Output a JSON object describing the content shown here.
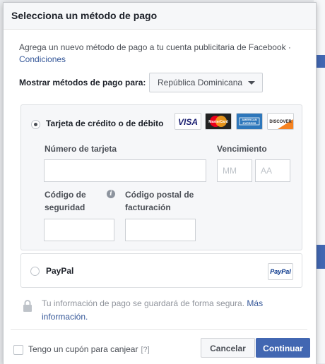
{
  "dialog": {
    "title": "Selecciona un método de pago",
    "description": "Agrega un nuevo método de pago a tu cuenta publicitaria de Facebook ·",
    "conditions_link": "Condiciones"
  },
  "show_methods": {
    "label": "Mostrar métodos de pago para:",
    "country": "República Dominicana"
  },
  "card_option": {
    "label": "Tarjeta de crédito o de débito",
    "selected": true,
    "logos": [
      "VISA",
      "MasterCard",
      "AMERICAN EXPRESS",
      "DISCOVER"
    ],
    "card_number_label": "Número de tarjeta",
    "expiry_label": "Vencimiento",
    "month_placeholder": "MM",
    "year_placeholder": "AA",
    "security_code_label_1": "Código de",
    "security_code_label_2": "seguridad",
    "postal_code_label_1": "Código postal de",
    "postal_code_label_2": "facturación"
  },
  "paypal_option": {
    "label": "PayPal",
    "selected": false,
    "logo_text": "PayPal"
  },
  "secure_note": {
    "text": "Tu información de pago se guardará de forma segura.",
    "link_1": "Más",
    "link_2": "información."
  },
  "footer": {
    "coupon_label": "Tengo un cupón para canjear",
    "coupon_help": "[?]",
    "cancel_label": "Cancelar",
    "continue_label": "Continuar"
  },
  "colors": {
    "primary": "#4267b2",
    "link": "#365899",
    "visa_blue": "#1a1f71",
    "amex_blue": "#2e77bb",
    "discover_orange": "#f58220",
    "mastercard_red": "#eb001b",
    "mastercard_yellow": "#f79e1b"
  }
}
